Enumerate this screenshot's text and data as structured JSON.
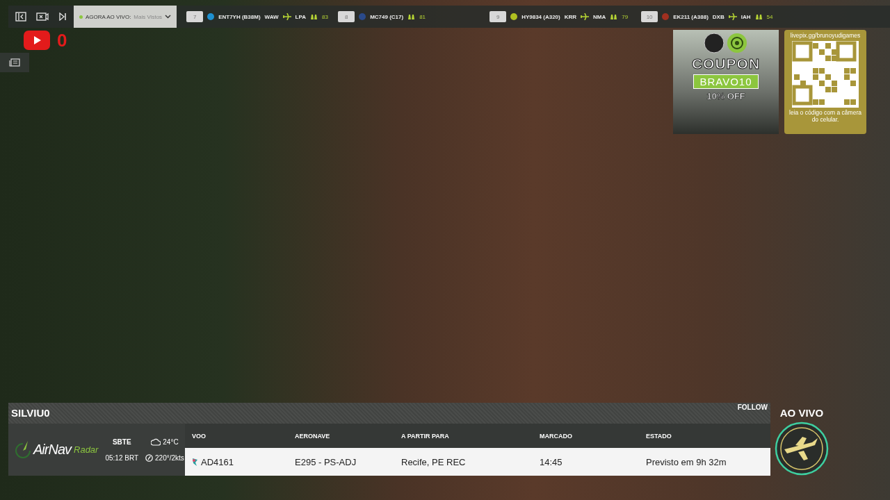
{
  "toolbar": {
    "feed_label": "AGORA AO VIVO:",
    "feed_value": "Mais Vistos"
  },
  "top_flights": [
    {
      "rank": "7",
      "flight": "ENT7YH",
      "aircraft": "(B38M)",
      "from": "WAW",
      "to": "LPA",
      "watchers": "83",
      "color": "#1e90d0"
    },
    {
      "rank": "8",
      "flight": "MC749",
      "aircraft": "(C17)",
      "watchers": "81",
      "color": "#2a4a8a"
    },
    {
      "rank": "9",
      "flight": "HY9834",
      "aircraft": "(A320)",
      "from": "KRR",
      "to": "NMA",
      "watchers": "79",
      "color": "#b0c020"
    },
    {
      "rank": "10",
      "flight": "EK211",
      "aircraft": "(A388)",
      "from": "DXB",
      "to": "IAH",
      "watchers": "54",
      "color": "#a03020"
    }
  ],
  "youtube": {
    "count": "0"
  },
  "coupon": {
    "title": "COUPON",
    "code": "BRAVO10",
    "discount": "10% OFF"
  },
  "qr": {
    "url": "livepix.gg/brunoyudigames",
    "caption": "leia o código com a câmera do celular."
  },
  "flight_panel": {
    "callsign": "SILVIU0",
    "follow": "FOLLOW",
    "logo_name": "AirNav",
    "logo_suffix": "Radar",
    "airport": "SBTE",
    "local_time": "05:12 BRT",
    "temperature": "24°C",
    "wind": "220°/2kts",
    "columns": [
      "VOO",
      "AERONAVE",
      "A PARTIR PARA",
      "MARCADO",
      "ESTADO"
    ],
    "row": [
      "AD4161",
      "E295 - PS-ADJ",
      "Recife, PE REC",
      "14:45",
      "Previsto em 9h 32m"
    ]
  },
  "live_badge": {
    "label": "AO VIVO"
  }
}
